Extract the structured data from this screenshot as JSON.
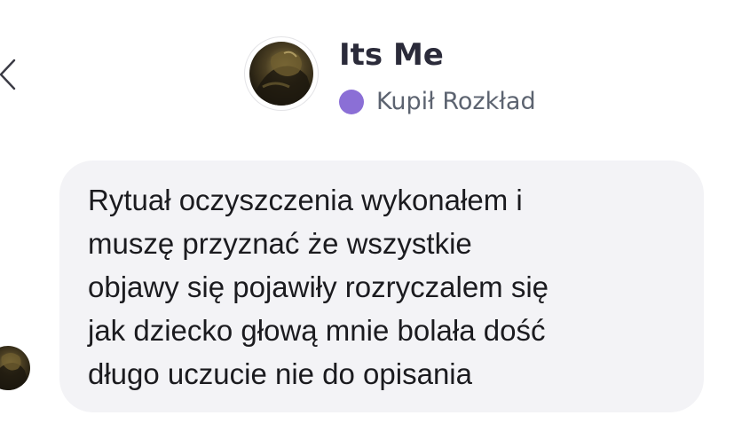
{
  "header": {
    "contact_name": "Its Me",
    "status_label": "Kupił Rozkład",
    "status_color": "#8b6fd6",
    "avatar_icon": "profile-photo"
  },
  "navigation": {
    "back_icon": "chevron-left-icon"
  },
  "message": {
    "lines": [
      "Rytuał oczyszczenia wykonałem i",
      "muszę przyznać że wszystkie",
      "objawy się pojawiły rozryczalem się",
      "jak dziecko głową mnie bolała dość",
      "długo uczucie nie do opisania"
    ],
    "bubble_color": "#f3f3f6"
  }
}
